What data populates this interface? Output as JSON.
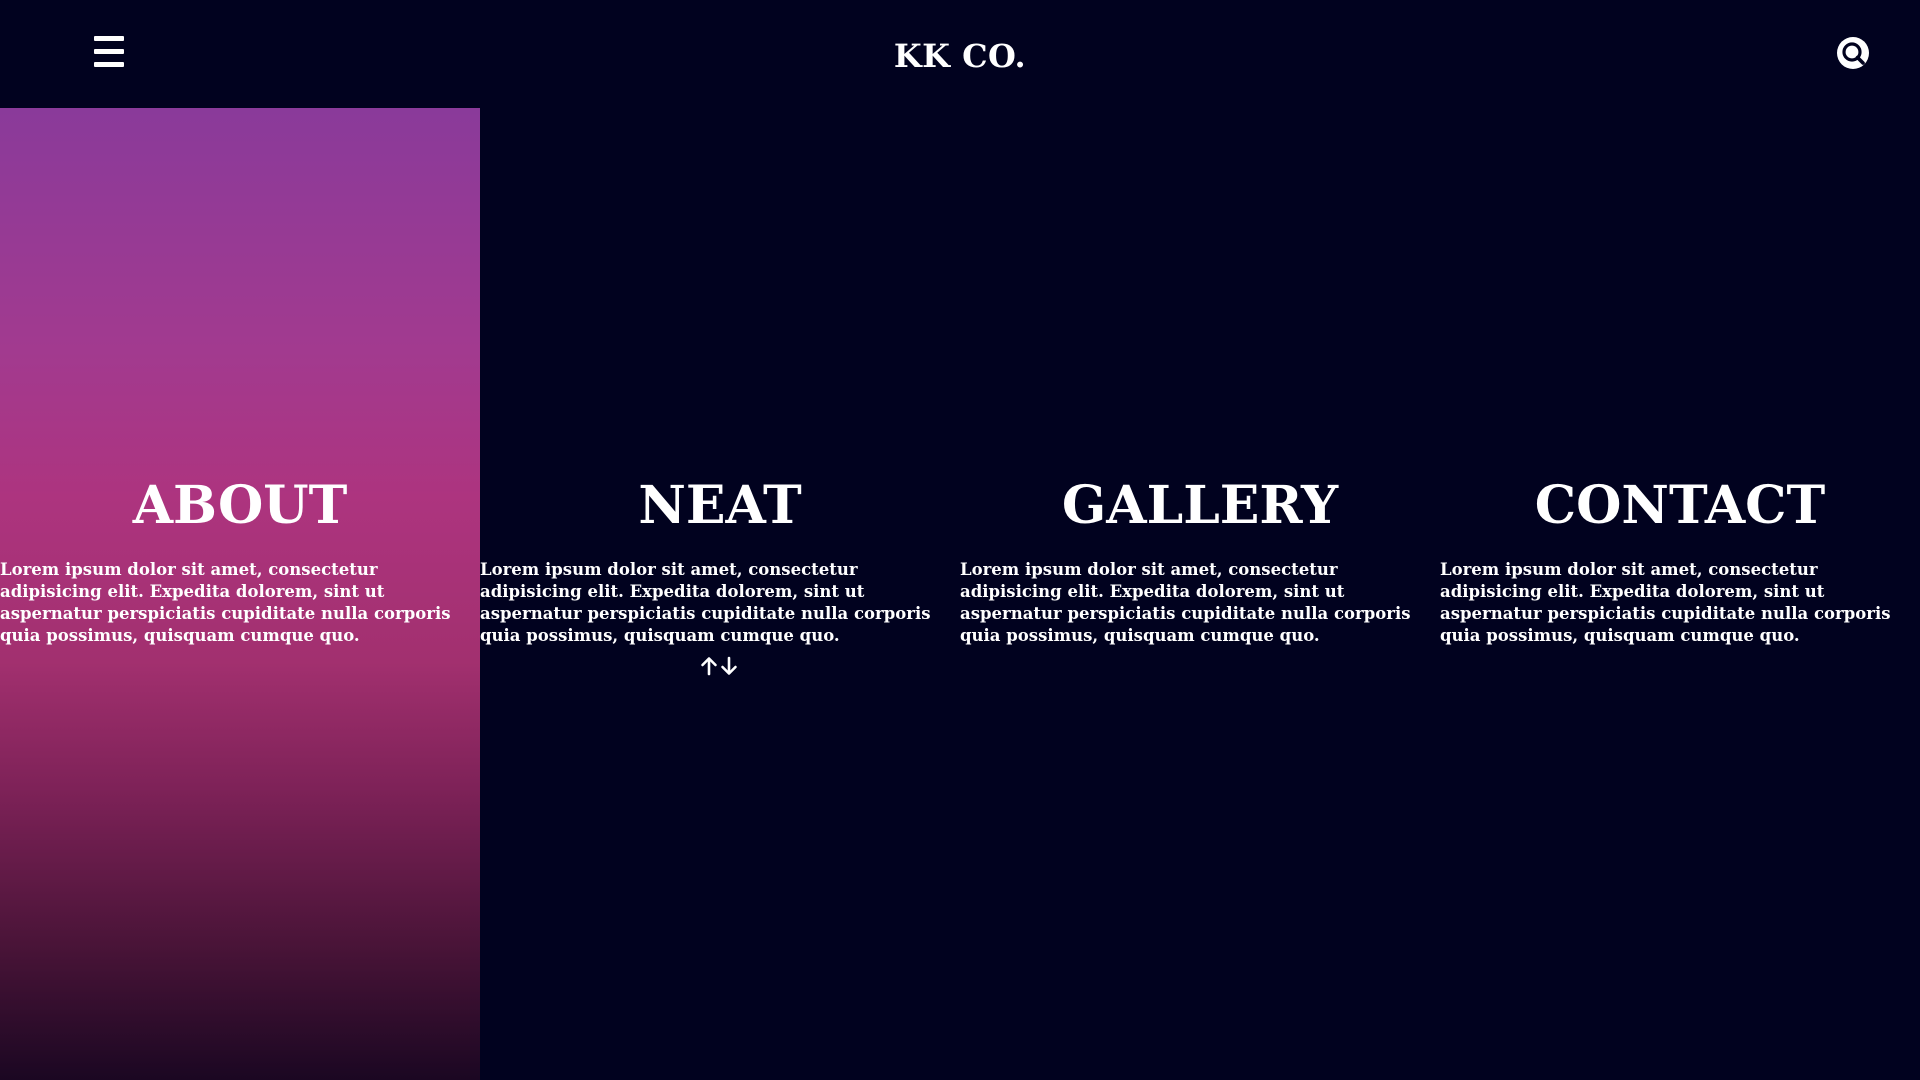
{
  "header": {
    "brand": "KK CO.",
    "menu_icon": "hamburger-menu-icon",
    "search_icon": "search-icon"
  },
  "panels": [
    {
      "title": "ABOUT",
      "text": "Lorem ipsum dolor sit amet, consectetur adipisicing elit. Expedita dolorem, sint ut aspernatur perspiciatis cupiditate nulla corporis quia possimus, quisquam cumque quo.",
      "active": true
    },
    {
      "title": "NEAT",
      "text": "Lorem ipsum dolor sit amet, consectetur adipisicing elit. Expedita dolorem, sint ut aspernatur perspiciatis cupiditate nulla corporis quia possimus, quisquam cumque quo.",
      "active": false
    },
    {
      "title": "GALLERY",
      "text": "Lorem ipsum dolor sit amet, consectetur adipisicing elit. Expedita dolorem, sint ut aspernatur perspiciatis cupiditate nulla corporis quia possimus, quisquam cumque quo.",
      "active": false
    },
    {
      "title": "CONTACT",
      "text": "Lorem ipsum dolor sit amet, consectetur adipisicing elit. Expedita dolorem, sint ut aspernatur perspiciatis cupiditate nulla corporis quia possimus, quisquam cumque quo.",
      "active": false
    }
  ],
  "scroll_icon": "up-down-arrows-icon",
  "colors": {
    "background": "#01021f",
    "active_gradient_top": "#8a3a9a",
    "active_gradient_mid": "#ad347f",
    "active_gradient_bottom": "#1b0722",
    "text": "#ffffff"
  }
}
